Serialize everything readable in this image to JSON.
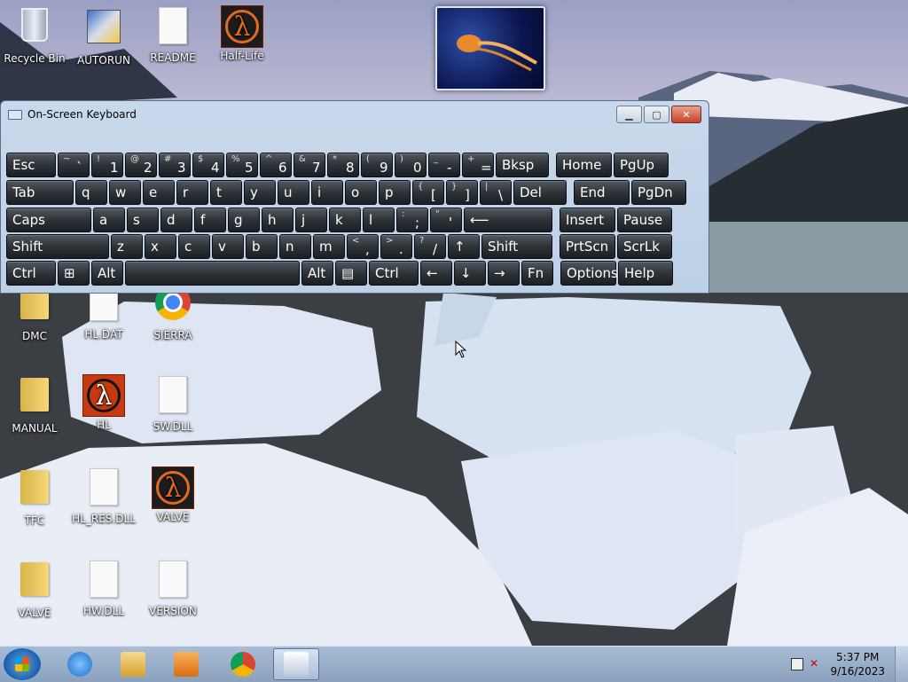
{
  "desktop": {
    "icons": [
      {
        "label": "Recycle Bin",
        "icon": "recycle-bin-icon"
      },
      {
        "label": "AUTORUN",
        "icon": "setup-icon"
      },
      {
        "label": "README",
        "icon": "text-file-icon"
      },
      {
        "label": "Half-Life",
        "icon": "half-life-shortcut-icon"
      },
      {
        "label": "DMC",
        "icon": "folder-icon"
      },
      {
        "label": "HL.DAT",
        "icon": "file-icon"
      },
      {
        "label": "SIERRA",
        "icon": "chrome-shortcut-icon"
      },
      {
        "label": "MANUAL",
        "icon": "folder-icon"
      },
      {
        "label": "HL",
        "icon": "half-life-icon"
      },
      {
        "label": "SW.DLL",
        "icon": "dll-file-icon"
      },
      {
        "label": "TFC",
        "icon": "folder-icon"
      },
      {
        "label": "HL_RES.DLL",
        "icon": "dll-file-icon"
      },
      {
        "label": "VALVE",
        "icon": "valve-icon"
      },
      {
        "label": "VALVE",
        "icon": "folder-icon"
      },
      {
        "label": "HW.DLL",
        "icon": "dll-file-icon"
      },
      {
        "label": "VERSION",
        "icon": "text-file-icon"
      }
    ]
  },
  "osk": {
    "title": "On-Screen Keyboard",
    "minimize": "▁",
    "maximize": "▢",
    "close": "✕",
    "rows": [
      [
        {
          "t": "Esc"
        },
        {
          "u": "~",
          "d": "`"
        },
        {
          "u": "!",
          "d": "1"
        },
        {
          "u": "@",
          "d": "2"
        },
        {
          "u": "#",
          "d": "3"
        },
        {
          "u": "$",
          "d": "4"
        },
        {
          "u": "%",
          "d": "5"
        },
        {
          "u": "^",
          "d": "6"
        },
        {
          "u": "&",
          "d": "7"
        },
        {
          "u": "*",
          "d": "8"
        },
        {
          "u": "(",
          "d": "9"
        },
        {
          "u": ")",
          "d": "0"
        },
        {
          "u": "_",
          "d": "-"
        },
        {
          "u": "+",
          "d": "="
        },
        {
          "t": "Bksp"
        },
        {
          "t": "Home"
        },
        {
          "t": "PgUp"
        }
      ],
      [
        {
          "t": "Tab"
        },
        {
          "t": "q"
        },
        {
          "t": "w"
        },
        {
          "t": "e"
        },
        {
          "t": "r"
        },
        {
          "t": "t"
        },
        {
          "t": "y"
        },
        {
          "t": "u"
        },
        {
          "t": "i"
        },
        {
          "t": "o"
        },
        {
          "t": "p"
        },
        {
          "u": "{",
          "d": "["
        },
        {
          "u": "}",
          "d": "]"
        },
        {
          "u": "|",
          "d": "\\"
        },
        {
          "t": "Del"
        },
        {
          "t": "End"
        },
        {
          "t": "PgDn"
        }
      ],
      [
        {
          "t": "Caps"
        },
        {
          "t": "a"
        },
        {
          "t": "s"
        },
        {
          "t": "d"
        },
        {
          "t": "f"
        },
        {
          "t": "g"
        },
        {
          "t": "h"
        },
        {
          "t": "j"
        },
        {
          "t": "k"
        },
        {
          "t": "l"
        },
        {
          "u": ":",
          "d": ";"
        },
        {
          "u": "\"",
          "d": "'"
        },
        {
          "t": "⟵"
        },
        {
          "t": "Insert"
        },
        {
          "t": "Pause"
        }
      ],
      [
        {
          "t": "Shift"
        },
        {
          "t": "z"
        },
        {
          "t": "x"
        },
        {
          "t": "c"
        },
        {
          "t": "v"
        },
        {
          "t": "b"
        },
        {
          "t": "n"
        },
        {
          "t": "m"
        },
        {
          "u": "<",
          "d": ","
        },
        {
          "u": ">",
          "d": "."
        },
        {
          "u": "?",
          "d": "/"
        },
        {
          "t": "↑"
        },
        {
          "t": "Shift"
        },
        {
          "t": "PrtScn"
        },
        {
          "t": "ScrLk"
        }
      ],
      [
        {
          "t": "Ctrl"
        },
        {
          "t": "⊞"
        },
        {
          "t": "Alt"
        },
        {
          "t": ""
        },
        {
          "t": "Alt"
        },
        {
          "t": "▤"
        },
        {
          "t": "Ctrl"
        },
        {
          "t": "←"
        },
        {
          "t": "↓"
        },
        {
          "t": "→"
        },
        {
          "t": "Fn"
        },
        {
          "t": "Options"
        },
        {
          "t": "Help"
        }
      ]
    ]
  },
  "taskbar": {
    "items": [
      {
        "icon": "ie-icon"
      },
      {
        "icon": "explorer-icon"
      },
      {
        "icon": "media-player-icon"
      },
      {
        "icon": "chrome-icon"
      },
      {
        "icon": "keyboard-icon"
      }
    ],
    "time": "5:37 PM",
    "date": "9/16/2023"
  }
}
